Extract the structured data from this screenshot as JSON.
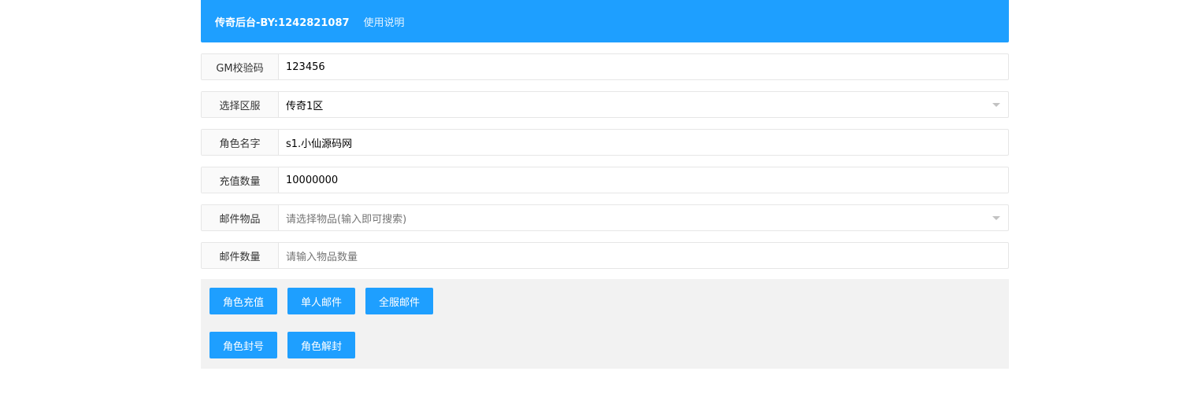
{
  "header": {
    "title": "传奇后台-BY:1242821087",
    "help_link": "使用说明"
  },
  "form": {
    "gm_code": {
      "label": "GM校验码",
      "value": "123456"
    },
    "server": {
      "label": "选择区服",
      "value": "传奇1区"
    },
    "role_name": {
      "label": "角色名字",
      "value": "s1.小仙源码网"
    },
    "recharge_amount": {
      "label": "充值数量",
      "value": "10000000"
    },
    "mail_item": {
      "label": "邮件物品",
      "placeholder": "请选择物品(输入即可搜索)"
    },
    "mail_count": {
      "label": "邮件数量",
      "placeholder": "请输入物品数量"
    }
  },
  "buttons": {
    "row1": [
      "角色充值",
      "单人邮件",
      "全服邮件"
    ],
    "row2": [
      "角色封号",
      "角色解封"
    ]
  },
  "colors": {
    "accent": "#1e9fff",
    "panel_bg": "#f2f2f2",
    "border": "#e6e6e6"
  }
}
